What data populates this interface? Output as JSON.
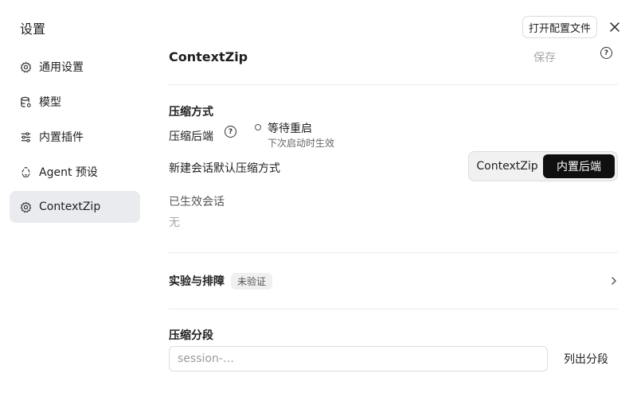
{
  "window": {
    "title": "设置"
  },
  "header": {
    "open_config_label": "打开配置文件",
    "close_icon": "close-icon"
  },
  "sidebar": {
    "items": [
      {
        "label": "通用设置",
        "icon": "gear-icon",
        "active": false
      },
      {
        "label": "模型",
        "icon": "database-icon",
        "active": false
      },
      {
        "label": "内置插件",
        "icon": "sliders-icon",
        "active": false
      },
      {
        "label": "Agent 预设",
        "icon": "recycle-icon",
        "active": false
      },
      {
        "label": "ContextZip",
        "icon": "gear-icon",
        "active": true
      }
    ]
  },
  "main": {
    "heading": "ContextZip",
    "save_label": "保存",
    "help_icon": "help-icon",
    "compression": {
      "title": "压缩方式",
      "backend_label": "压缩后端",
      "status_main": "等待重启",
      "status_sub": "下次启动时生效",
      "default_label": "新建会话默认压缩方式",
      "options": [
        "ContextZip",
        "内置后端"
      ],
      "selected": "内置后端",
      "active_sessions_label": "已生效会话",
      "active_sessions_value": "无"
    },
    "experiment": {
      "title": "实验与排障",
      "badge": "未验证"
    },
    "segments": {
      "title": "压缩分段",
      "input_placeholder": "session-…",
      "input_value": "",
      "list_button": "列出分段"
    }
  },
  "colors": {
    "active_bg": "#e9ebef",
    "segment_active": "#0f0f10",
    "muted": "#a8a8a8"
  }
}
